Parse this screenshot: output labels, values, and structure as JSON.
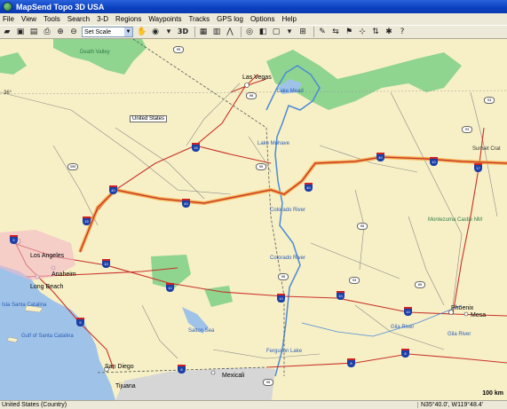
{
  "window": {
    "title": "MapSend Topo 3D USA"
  },
  "menu": [
    "File",
    "View",
    "Tools",
    "Search",
    "3-D",
    "Regions",
    "Waypoints",
    "Tracks",
    "GPS log",
    "Options",
    "Help"
  ],
  "toolbar": {
    "scale_value": "Set Scale",
    "mode_3d_label": "3D"
  },
  "map": {
    "places": [
      {
        "name": "Las Vegas",
        "id": "las-vegas"
      },
      {
        "name": "Lake Mead",
        "id": "lake-mead"
      },
      {
        "name": "Lake Mohave",
        "id": "lake-mohave"
      },
      {
        "name": "Colorado River",
        "id": "colorado-river-1"
      },
      {
        "name": "Colorado River",
        "id": "colorado-river-2"
      },
      {
        "name": "Death Valley",
        "id": "death-valley"
      },
      {
        "name": "Sunset Crat",
        "id": "sunset-crater"
      },
      {
        "name": "Montezuma Castle NM",
        "id": "montezuma"
      },
      {
        "name": "Los Angeles",
        "id": "los-angeles"
      },
      {
        "name": "Anaheim",
        "id": "anaheim"
      },
      {
        "name": "Long Beach",
        "id": "long-beach"
      },
      {
        "name": "Isla Santa Catalina",
        "id": "santa-catalina"
      },
      {
        "name": "Gulf of Santa Catalina",
        "id": "gulf-santa-catalina"
      },
      {
        "name": "Salton Sea",
        "id": "salton-sea"
      },
      {
        "name": "Ferguson Lake",
        "id": "ferguson-lake"
      },
      {
        "name": "San Diego",
        "id": "san-diego"
      },
      {
        "name": "Tijuana",
        "id": "tijuana"
      },
      {
        "name": "Mexicali",
        "id": "mexicali"
      },
      {
        "name": "Phoenix",
        "id": "phoenix"
      },
      {
        "name": "Mesa",
        "id": "mesa"
      },
      {
        "name": "Gila River",
        "id": "gila-river-1"
      },
      {
        "name": "Gila River",
        "id": "gila-river-2"
      }
    ],
    "region_label": "United States",
    "lat_label": "36°",
    "scale_label": "100 km",
    "shields": {
      "interstates": [
        "15",
        "15",
        "40",
        "40",
        "40",
        "40",
        "10",
        "10",
        "10",
        "10",
        "10",
        "10",
        "5",
        "8",
        "8",
        "8",
        "17",
        "5"
      ],
      "us_highways": [
        "95",
        "395",
        "95",
        "93",
        "95",
        "95",
        "93",
        "89",
        "95",
        "98",
        "93"
      ]
    }
  },
  "status": {
    "region": "United States (Country)",
    "coords": "N35°40.0', W119°48.4'"
  },
  "colors": {
    "land": "#f7f0c6",
    "water": "#9fc3e8",
    "park": "#8fd48f",
    "route": "#f2a23a",
    "interstate": "#1a3fa8"
  }
}
